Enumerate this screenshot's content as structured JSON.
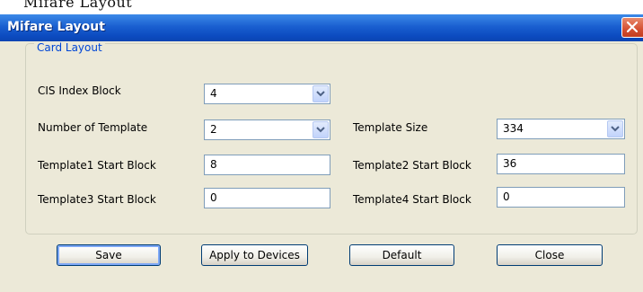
{
  "top_text": "Mifare Layout",
  "window": {
    "title": "Mifare Layout",
    "close_icon": "close-x-icon",
    "colors": {
      "titlebar": "#0c4bc0",
      "close": "#d55032",
      "face": "#ece9d8",
      "group_label": "#0046d5"
    }
  },
  "group": {
    "label": "Card Layout"
  },
  "fields": {
    "cis_index_block": {
      "label": "CIS Index Block",
      "value": "4"
    },
    "number_of_template": {
      "label": "Number of Template",
      "value": "2"
    },
    "template_size": {
      "label": "Template Size",
      "value": "334"
    },
    "template1_start": {
      "label": "Template1 Start Block",
      "value": "8"
    },
    "template2_start": {
      "label": "Template2 Start Block",
      "value": "36"
    },
    "template3_start": {
      "label": "Template3 Start Block",
      "value": "0"
    },
    "template4_start": {
      "label": "Template4 Start Block",
      "value": "0"
    }
  },
  "buttons": {
    "save": "Save",
    "apply": "Apply to Devices",
    "default": "Default",
    "close": "Close"
  }
}
